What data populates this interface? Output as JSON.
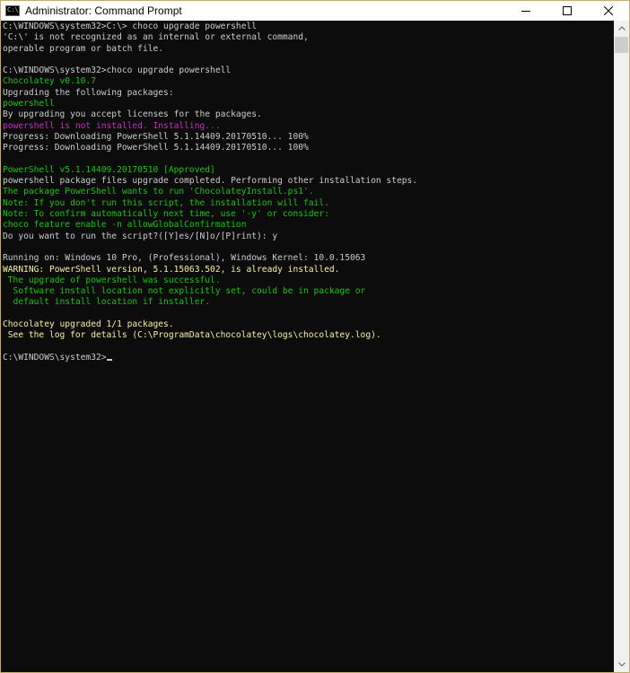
{
  "window": {
    "title": "Administrator: Command Prompt",
    "icon_label": "C:\\"
  },
  "colors": {
    "white": "#cccccc",
    "green": "#16c60c",
    "magenta": "#c62dc6",
    "yellow": "#f9f1a5"
  },
  "console": {
    "lines": [
      {
        "text": "C:\\WINDOWS\\system32>C:\\> choco upgrade powershell",
        "color": "white"
      },
      {
        "text": "'C:\\' is not recognized as an internal or external command,",
        "color": "white"
      },
      {
        "text": "operable program or batch file.",
        "color": "white"
      },
      {
        "text": "",
        "color": "white"
      },
      {
        "text": "C:\\WINDOWS\\system32>choco upgrade powershell",
        "color": "white"
      },
      {
        "text": "Chocolatey v0.10.7",
        "color": "green"
      },
      {
        "text": "Upgrading the following packages:",
        "color": "white"
      },
      {
        "text": "powershell",
        "color": "green"
      },
      {
        "text": "By upgrading you accept licenses for the packages.",
        "color": "white"
      },
      {
        "text": "powershell is not installed. Installing...",
        "color": "magenta"
      },
      {
        "text": "Progress: Downloading PowerShell 5.1.14409.20170510... 100%",
        "color": "white"
      },
      {
        "text": "Progress: Downloading PowerShell 5.1.14409.20170510... 100%",
        "color": "white"
      },
      {
        "text": "",
        "color": "white"
      },
      {
        "text": "PowerShell v5.1.14409.20170510 [Approved]",
        "color": "green"
      },
      {
        "text": "powershell package files upgrade completed. Performing other installation steps.",
        "color": "white"
      },
      {
        "text": "The package PowerShell wants to run 'ChocolateyInstall.ps1'.",
        "color": "green"
      },
      {
        "text": "Note: If you don't run this script, the installation will fail.",
        "color": "green"
      },
      {
        "text": "Note: To confirm automatically next time, use '-y' or consider:",
        "color": "green"
      },
      {
        "text": "choco feature enable -n allowGlobalConfirmation",
        "color": "green"
      },
      {
        "text": "Do you want to run the script?([Y]es/[N]o/[P]rint): y",
        "color": "white"
      },
      {
        "text": "",
        "color": "white"
      },
      {
        "text": "Running on: Windows 10 Pro, (Professional), Windows Kernel: 10.0.15063",
        "color": "white"
      },
      {
        "text": "WARNING: PowerShell version, 5.1.15063.502, is already installed.",
        "color": "yellow"
      },
      {
        "text": " The upgrade of powershell was successful.",
        "color": "green"
      },
      {
        "text": "  Software install location not explicitly set, could be in package or",
        "color": "green"
      },
      {
        "text": "  default install location if installer.",
        "color": "green"
      },
      {
        "text": "",
        "color": "white"
      },
      {
        "text": "Chocolatey upgraded 1/1 packages.",
        "color": "yellow"
      },
      {
        "text": " See the log for details (C:\\ProgramData\\chocolatey\\logs\\chocolatey.log).",
        "color": "yellow"
      },
      {
        "text": "",
        "color": "white"
      }
    ],
    "prompt": "C:\\WINDOWS\\system32>"
  }
}
